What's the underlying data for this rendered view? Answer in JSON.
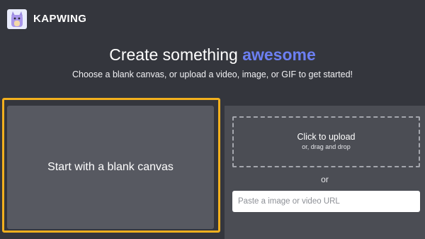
{
  "header": {
    "brand": "KAPWING",
    "logo_icon": "kapwing-mascot-icon"
  },
  "hero": {
    "title_prefix": "Create something ",
    "title_accent": "awesome",
    "subtitle": "Choose a blank canvas, or upload a video, image, or GIF to get started!"
  },
  "blank_canvas": {
    "label": "Start with a blank canvas"
  },
  "upload": {
    "title": "Click to upload",
    "subtitle": "or, drag and drop",
    "or": "or",
    "url_placeholder": "Paste a image or video URL"
  },
  "colors": {
    "background": "#34363d",
    "accent": "#6c7ff2",
    "highlight": "#f2b01e",
    "card": "#575961",
    "panel": "#4b4d54"
  }
}
